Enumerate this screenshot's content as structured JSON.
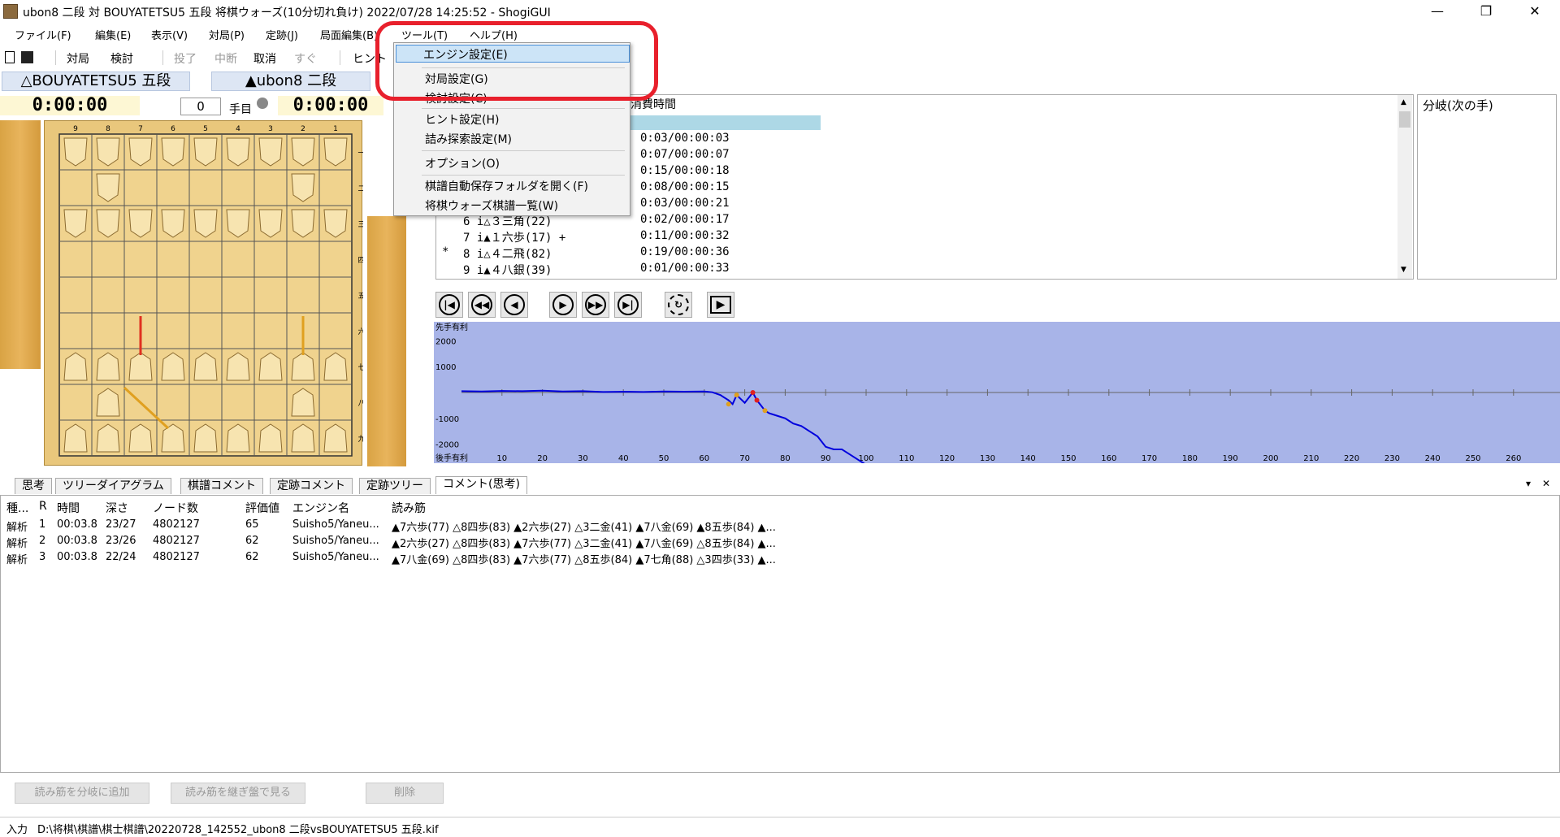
{
  "window": {
    "title": "ubon8 二段 対 BOUYATETSU5 五段 将棋ウォーズ(10分切れ負け) 2022/07/28 14:25:52 - ShogiGUI",
    "minimize": "—",
    "maximize": "❐",
    "close": "✕"
  },
  "menu": {
    "file": "ファイル(F)",
    "edit": "編集(E)",
    "view": "表示(V)",
    "game": "対局(P)",
    "joseki": "定跡(J)",
    "board_edit": "局面編集(B)",
    "tools": "ツール(T)",
    "help": "ヘルプ(H)"
  },
  "toolbar": {
    "play": "対局",
    "analyze": "検討",
    "resign": "投了",
    "interrupt": "中断",
    "cancel": "取消",
    "now": "すぐ",
    "hint": "ヒント"
  },
  "players": {
    "gote": "△BOUYATETSU5 五段",
    "sente": "▲ubon8 二段",
    "gote_time": "0:00:00",
    "sente_time": "0:00:00",
    "move_number": "0",
    "move_label": "手目"
  },
  "board": {
    "files": [
      "9",
      "8",
      "7",
      "6",
      "5",
      "4",
      "3",
      "2",
      "1"
    ],
    "ranks": [
      "一",
      "二",
      "三",
      "四",
      "五",
      "六",
      "七",
      "八",
      "九"
    ]
  },
  "kifu": {
    "header_time": "消費時間",
    "rows": [
      {
        "mark": "",
        "move": "",
        "time": "0:03/00:00:03"
      },
      {
        "mark": "",
        "move": "",
        "time": "0:07/00:00:07"
      },
      {
        "mark": "",
        "move": "",
        "time": "0:15/00:00:18"
      },
      {
        "mark": "",
        "move": "",
        "time": "0:08/00:00:15"
      },
      {
        "mark": "",
        "move": "",
        "time": "0:03/00:00:21"
      },
      {
        "mark": "",
        "move": "6 i△３三角(22)",
        "time": "0:02/00:00:17"
      },
      {
        "mark": "",
        "move": "7 i▲１六歩(17) +",
        "time": "0:11/00:00:32"
      },
      {
        "mark": "*",
        "move": "8 i△４二飛(82)",
        "time": "0:19/00:00:36"
      },
      {
        "mark": "",
        "move": "9 i▲４八銀(39)",
        "time": "0:01/00:00:33"
      }
    ],
    "branch_title": "分岐(次の手)"
  },
  "graph": {
    "top_label": "先手有利",
    "bottom_label": "後手有利",
    "y_ticks": [
      "2000",
      "1000",
      "-1000",
      "-2000"
    ],
    "x_ticks": [
      "10",
      "20",
      "30",
      "40",
      "50",
      "60",
      "70",
      "80",
      "90",
      "100",
      "110",
      "120",
      "130",
      "140",
      "150",
      "160",
      "170",
      "180",
      "190",
      "200",
      "210",
      "220",
      "230",
      "240",
      "250",
      "260"
    ],
    "line_color": "#0000dd",
    "bg_color": "#a8b4e8"
  },
  "tabs": [
    "思考",
    "ツリーダイアグラム",
    "棋譜コメント",
    "定跡コメント",
    "定跡ツリー",
    "コメント(思考)"
  ],
  "analysis": {
    "headers": [
      "種...",
      "R",
      "時間",
      "深さ",
      "ノード数",
      "評価値",
      "エンジン名",
      "読み筋"
    ],
    "rows": [
      [
        "解析",
        "1",
        "00:03.8",
        "23/27",
        "4802127",
        "65",
        "Suisho5/Yaneu...",
        "▲7六歩(77) △8四歩(83) ▲2六歩(27) △3二金(41) ▲7八金(69) ▲8五歩(84) ▲..."
      ],
      [
        "解析",
        "2",
        "00:03.8",
        "23/26",
        "4802127",
        "62",
        "Suisho5/Yaneu...",
        "▲2六歩(27) △8四歩(83) ▲7六歩(77) △3二金(41) ▲7八金(69) △8五歩(84) ▲..."
      ],
      [
        "解析",
        "3",
        "00:03.8",
        "22/24",
        "4802127",
        "62",
        "Suisho5/Yaneu...",
        "▲7八金(69) △8四歩(83) ▲7六歩(77) △8五歩(84) ▲7七角(88) △3四歩(33) ▲..."
      ]
    ],
    "buttons": [
      "読み筋を分岐に追加",
      "読み筋を継ぎ盤で見る",
      "削除"
    ]
  },
  "status": {
    "label": "入力",
    "path": "D:\\将棋\\棋譜\\棋士棋譜\\20220728_142552_ubon8 二段vsBOUYATETSU5 五段.kif"
  },
  "dropdown": {
    "items": [
      "エンジン設定(E)",
      "対局設定(G)",
      "検討設定(C)",
      "ヒント設定(H)",
      "詰み探索設定(M)",
      "オプション(O)",
      "棋譜自動保存フォルダを開く(F)",
      "将棋ウォーズ棋譜一覧(W)"
    ]
  },
  "tabs_controls": {
    "dropdown": "▾",
    "close": "✕"
  }
}
